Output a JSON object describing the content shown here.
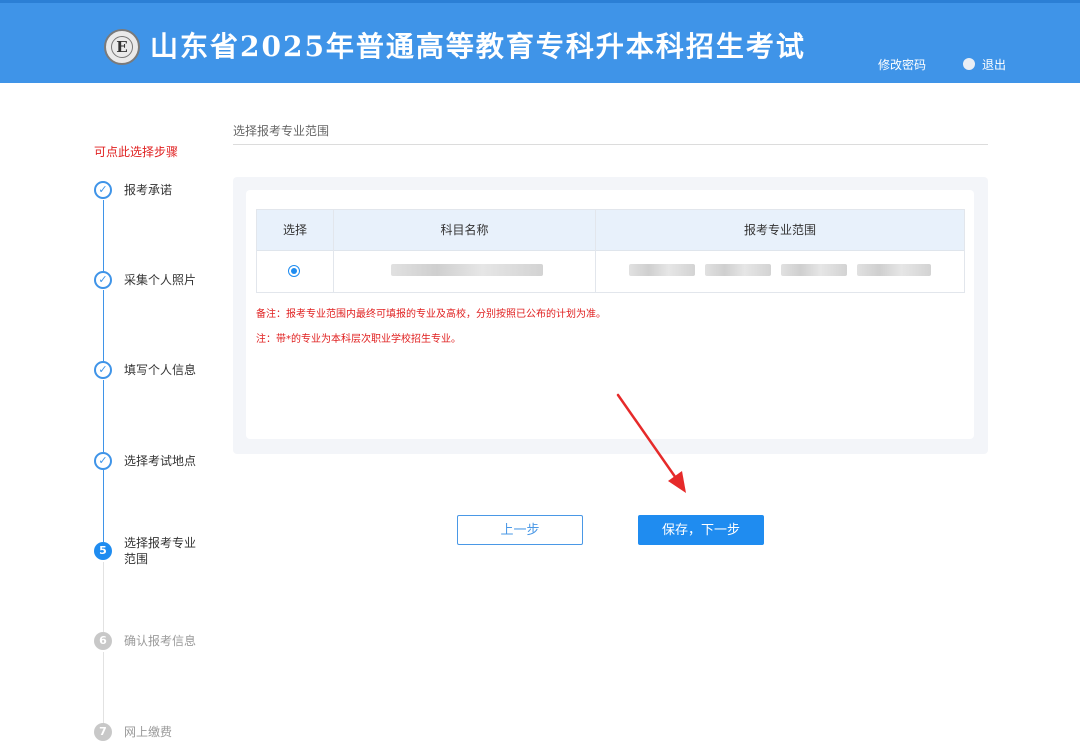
{
  "header": {
    "logo_letter": "E",
    "title": "山东省2025年普通高等教育专科升本科招生考试",
    "change_password": "修改密码",
    "logout": "退出"
  },
  "sidebar": {
    "hint": "可点此选择步骤",
    "steps": [
      {
        "num": "✓",
        "label": "报考承诺",
        "state": "done"
      },
      {
        "num": "✓",
        "label": "采集个人照片",
        "state": "done"
      },
      {
        "num": "✓",
        "label": "填写个人信息",
        "state": "done"
      },
      {
        "num": "✓",
        "label": "选择考试地点",
        "state": "done"
      },
      {
        "num": "5",
        "label": "选择报考专业范围",
        "state": "active"
      },
      {
        "num": "6",
        "label": "确认报考信息",
        "state": "todo"
      },
      {
        "num": "7",
        "label": "网上缴费",
        "state": "todo"
      }
    ]
  },
  "main": {
    "section_title": "选择报考专业范围",
    "table": {
      "headers": [
        "选择",
        "科目名称",
        "报考专业范围"
      ],
      "selected": true
    },
    "notes": [
      "备注：报考专业范围内最终可填报的专业及高校，分别按照已公布的计划为准。",
      "注：带*的专业为本科层次职业学校招生专业。"
    ],
    "prev_button": "上一步",
    "next_button": "保存，下一步"
  },
  "colors": {
    "header_bg": "#3f94e8",
    "accent": "#1f8cf0",
    "warning": "#e02020",
    "arrow": "#e62a2a"
  }
}
